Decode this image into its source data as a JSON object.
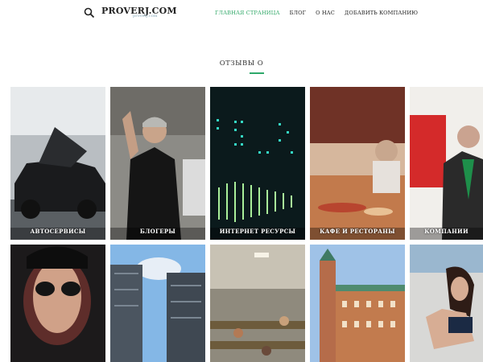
{
  "header": {
    "logo": "PROVERJ.COM",
    "logo_sub": "proverj.com",
    "nav": [
      {
        "label": "ГЛАВНАЯ СТРАНИЦА",
        "active": true
      },
      {
        "label": "БЛОГ",
        "active": false
      },
      {
        "label": "О НАС",
        "active": false
      },
      {
        "label": "ДОБАВИТЬ КОМПАНИЮ",
        "active": false
      }
    ]
  },
  "section": {
    "title": "ОТЗЫВЫ О"
  },
  "tiles": [
    {
      "label": "АВТОСЕРВИСЫ"
    },
    {
      "label": "БЛОГЕРЫ"
    },
    {
      "label": "ИНТЕРНЕТ РЕСУРСЫ"
    },
    {
      "label": "КАФЕ И РЕСТОРАНЫ"
    },
    {
      "label": "КОМПАНИИ"
    }
  ],
  "colors": {
    "accent": "#33a96a"
  }
}
